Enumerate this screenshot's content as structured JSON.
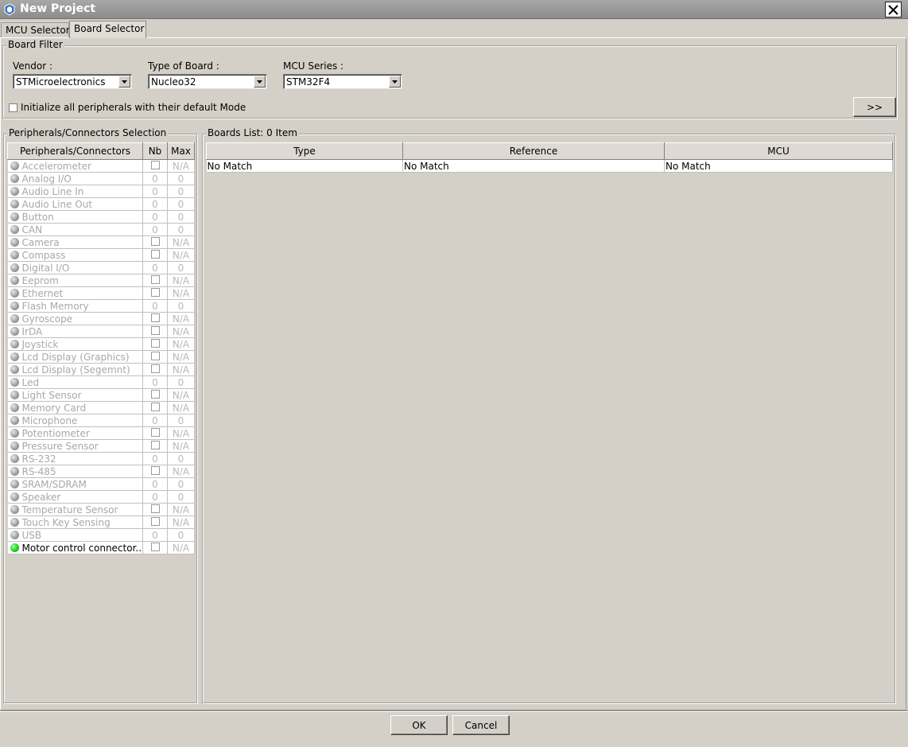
{
  "window": {
    "title": "New Project"
  },
  "tabs": [
    {
      "label": "MCU Selector",
      "active": false
    },
    {
      "label": "Board Selector",
      "active": true
    }
  ],
  "board_filter": {
    "legend": "Board Filter",
    "vendor": {
      "label": "Vendor :",
      "value": "STMicroelectronics"
    },
    "board_type": {
      "label": "Type of Board :",
      "value": "Nucleo32"
    },
    "mcu_series": {
      "label": "MCU Series :",
      "value": "STM32F4"
    },
    "init_checkbox_label": "Initialize all peripherals with their default Mode",
    "init_checked": false,
    "expand_label": ">>"
  },
  "peripherals": {
    "legend": "Peripherals/Connectors Selection",
    "headers": {
      "name": "Peripherals/Connectors",
      "nb": "Nb",
      "max": "Max"
    },
    "rows": [
      {
        "name": "Accelerometer",
        "nb": "",
        "max": "N/A",
        "checkbox": true,
        "active": false
      },
      {
        "name": "Analog I/O",
        "nb": "0",
        "max": "0",
        "checkbox": false,
        "active": false
      },
      {
        "name": "Audio Line In",
        "nb": "0",
        "max": "0",
        "checkbox": false,
        "active": false
      },
      {
        "name": "Audio Line Out",
        "nb": "0",
        "max": "0",
        "checkbox": false,
        "active": false
      },
      {
        "name": "Button",
        "nb": "0",
        "max": "0",
        "checkbox": false,
        "active": false
      },
      {
        "name": "CAN",
        "nb": "0",
        "max": "0",
        "checkbox": false,
        "active": false
      },
      {
        "name": "Camera",
        "nb": "",
        "max": "N/A",
        "checkbox": true,
        "active": false
      },
      {
        "name": "Compass",
        "nb": "",
        "max": "N/A",
        "checkbox": true,
        "active": false
      },
      {
        "name": "Digital I/O",
        "nb": "0",
        "max": "0",
        "checkbox": false,
        "active": false
      },
      {
        "name": "Eeprom",
        "nb": "",
        "max": "N/A",
        "checkbox": true,
        "active": false
      },
      {
        "name": "Ethernet",
        "nb": "",
        "max": "N/A",
        "checkbox": true,
        "active": false
      },
      {
        "name": "Flash Memory",
        "nb": "0",
        "max": "0",
        "checkbox": false,
        "active": false
      },
      {
        "name": "Gyroscope",
        "nb": "",
        "max": "N/A",
        "checkbox": true,
        "active": false
      },
      {
        "name": "IrDA",
        "nb": "",
        "max": "N/A",
        "checkbox": true,
        "active": false
      },
      {
        "name": "Joystick",
        "nb": "",
        "max": "N/A",
        "checkbox": true,
        "active": false
      },
      {
        "name": "Lcd Display (Graphics)",
        "nb": "",
        "max": "N/A",
        "checkbox": true,
        "active": false
      },
      {
        "name": "Lcd Display (Segemnt)",
        "nb": "",
        "max": "N/A",
        "checkbox": true,
        "active": false
      },
      {
        "name": "Led",
        "nb": "0",
        "max": "0",
        "checkbox": false,
        "active": false
      },
      {
        "name": "Light Sensor",
        "nb": "",
        "max": "N/A",
        "checkbox": true,
        "active": false
      },
      {
        "name": "Memory Card",
        "nb": "",
        "max": "N/A",
        "checkbox": true,
        "active": false
      },
      {
        "name": "Microphone",
        "nb": "0",
        "max": "0",
        "checkbox": false,
        "active": false
      },
      {
        "name": "Potentiometer",
        "nb": "",
        "max": "N/A",
        "checkbox": true,
        "active": false
      },
      {
        "name": "Pressure Sensor",
        "nb": "",
        "max": "N/A",
        "checkbox": true,
        "active": false
      },
      {
        "name": "RS-232",
        "nb": "0",
        "max": "0",
        "checkbox": false,
        "active": false
      },
      {
        "name": "RS-485",
        "nb": "",
        "max": "N/A",
        "checkbox": true,
        "active": false
      },
      {
        "name": "SRAM/SDRAM",
        "nb": "0",
        "max": "0",
        "checkbox": false,
        "active": false
      },
      {
        "name": "Speaker",
        "nb": "0",
        "max": "0",
        "checkbox": false,
        "active": false
      },
      {
        "name": "Temperature Sensor",
        "nb": "",
        "max": "N/A",
        "checkbox": true,
        "active": false
      },
      {
        "name": "Touch Key Sensing",
        "nb": "",
        "max": "N/A",
        "checkbox": true,
        "active": false
      },
      {
        "name": "USB",
        "nb": "0",
        "max": "0",
        "checkbox": false,
        "active": false
      },
      {
        "name": "Motor control connector...",
        "nb": "",
        "max": "N/A",
        "checkbox": true,
        "active": true
      }
    ]
  },
  "boards": {
    "legend": "Boards List: 0 Item",
    "headers": {
      "type": "Type",
      "reference": "Reference",
      "mcu": "MCU"
    },
    "rows": [
      {
        "type": "No Match",
        "reference": "No Match",
        "mcu": "No Match"
      }
    ]
  },
  "footer": {
    "ok_label": "OK",
    "cancel_label": "Cancel"
  },
  "colors": {
    "background": "#d4d0c8",
    "titlebar": "#9a9a9a",
    "inactive_text": "#a8a8a8",
    "active_led": "#1ed01e"
  }
}
